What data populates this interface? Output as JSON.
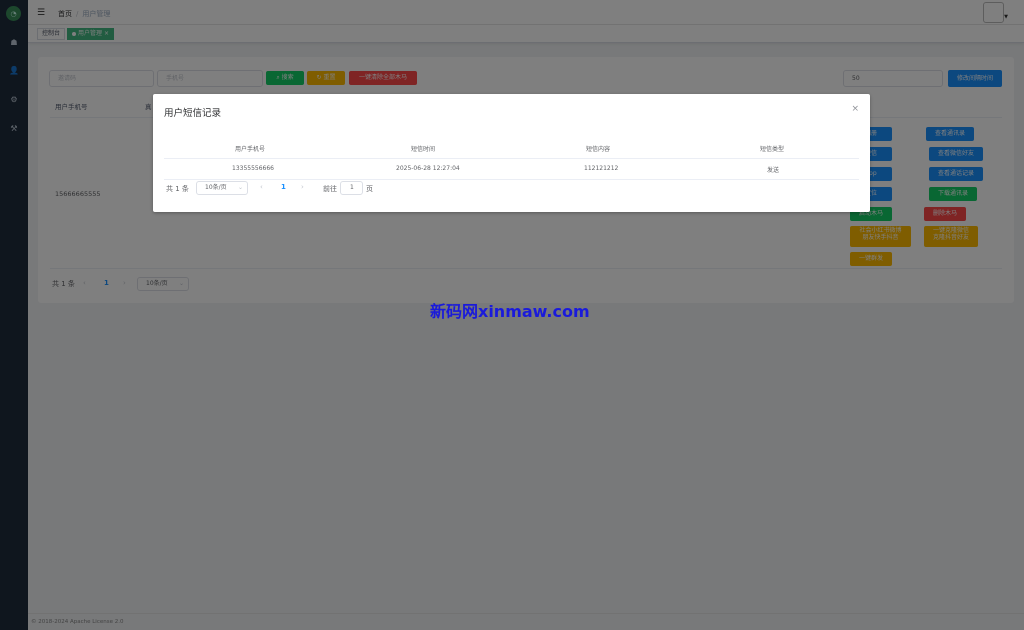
{
  "header": {
    "breadcrumb": [
      "首页",
      "用户管理"
    ],
    "sep": "/"
  },
  "tags": [
    {
      "label": "控制台"
    },
    {
      "label": "用户管理",
      "close": "×"
    }
  ],
  "search": {
    "invite_placeholder": "邀请码",
    "phone_placeholder": "手机号",
    "search_label": "搜索",
    "reset_label": "重置",
    "clear_label": "一键清除全部木马",
    "interval_value": "50",
    "interval_button": "修改间隔时间"
  },
  "table": {
    "headers": [
      "用户手机号",
      "真"
    ],
    "row": {
      "phone": "15666665555"
    },
    "actions": [
      {
        "label": "相册",
        "color": "blue"
      },
      {
        "label": "查看通讯录",
        "color": "blue"
      },
      {
        "label": "短信",
        "color": "blue"
      },
      {
        "label": "查看微信好友",
        "color": "blue"
      },
      {
        "label": "app",
        "color": "blue"
      },
      {
        "label": "查看通话记录",
        "color": "blue"
      },
      {
        "label": "定位",
        "color": "blue"
      },
      {
        "label": "下载通讯录",
        "color": "green"
      },
      {
        "label": "启动木马",
        "color": "green"
      },
      {
        "label": "删除木马",
        "color": "red"
      },
      {
        "label": "社会小红书微博\n朋友快手抖音",
        "color": "orange"
      },
      {
        "label": "一键克隆微信\n克隆抖音好友",
        "color": "orange"
      },
      {
        "label": "一键群发",
        "color": "orange"
      }
    ]
  },
  "pagination": {
    "total": "共 1 条",
    "size": "10条/页",
    "page": "1"
  },
  "footer": "© 2018-2024 Apache License 2.0",
  "modal": {
    "title": "用户短信记录",
    "close": "×",
    "headers": [
      "用户手机号",
      "短信时间",
      "短信内容",
      "短信类型"
    ],
    "rows": [
      {
        "phone": "13355556666",
        "time": "2025-06-28 12:27:04",
        "content": "112121212",
        "type": "发送"
      }
    ],
    "pagination": {
      "total": "共 1 条",
      "size": "10条/页",
      "page": "1",
      "goto_label": "前往",
      "goto_value": "1",
      "goto_suffix": "页"
    }
  },
  "watermark": "新码网xinmaw.com",
  "icons": [
    "menu-icon",
    "dashboard-icon",
    "user-icon",
    "settings-icon",
    "tools-icon",
    "search-icon",
    "refresh-icon",
    "close-icon",
    "chevron-left-icon",
    "chevron-right-icon",
    "chevron-down-icon"
  ]
}
